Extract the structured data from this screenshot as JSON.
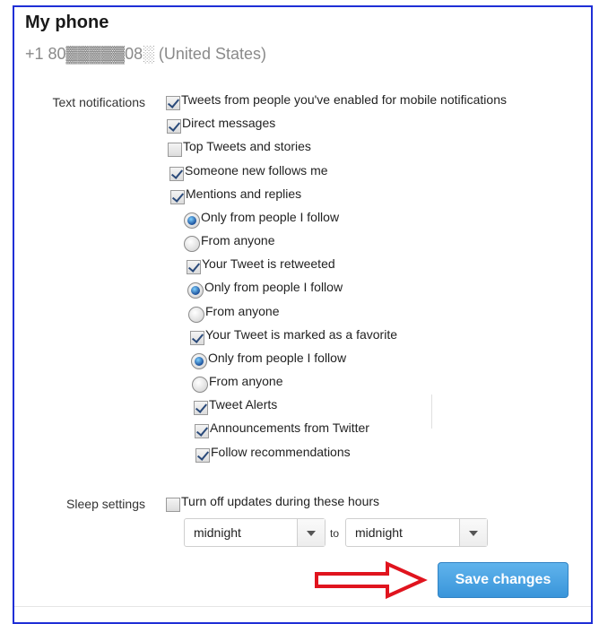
{
  "header": {
    "title": "My phone",
    "phone_number": "+1 80▓▓▓▓▓08░ (United States)"
  },
  "text_notifications": {
    "label": "Text notifications",
    "items": [
      {
        "label": "Tweets from people you've enabled for mobile notifications",
        "checked": true
      },
      {
        "label": "Direct messages",
        "checked": true
      },
      {
        "label": "Top Tweets and stories",
        "checked": false
      },
      {
        "label": "Someone new follows me",
        "checked": true
      },
      {
        "label": "Mentions and replies",
        "checked": true
      },
      {
        "label": "Only from people I follow",
        "type": "radio",
        "checked": true
      },
      {
        "label": "From anyone",
        "type": "radio",
        "checked": false
      },
      {
        "label": "Your Tweet is retweeted",
        "checked": true
      },
      {
        "label": "Only from people I follow",
        "type": "radio",
        "checked": true
      },
      {
        "label": "From anyone",
        "type": "radio",
        "checked": false
      },
      {
        "label": "Your Tweet is marked as a favorite",
        "checked": true
      },
      {
        "label": "Only from people I follow",
        "type": "radio",
        "checked": true
      },
      {
        "label": "From anyone",
        "type": "radio",
        "checked": false
      },
      {
        "label": "Tweet Alerts",
        "checked": true
      },
      {
        "label": "Announcements from Twitter",
        "checked": true
      },
      {
        "label": "Follow recommendations",
        "checked": true
      }
    ]
  },
  "sleep_settings": {
    "label": "Sleep settings",
    "checkbox_label": "Turn off updates during these hours",
    "checked": false,
    "from_value": "midnight",
    "to_label": "to",
    "to_value": "midnight"
  },
  "actions": {
    "save_label": "Save changes",
    "save_color": "#3a95da",
    "arrow_color": "#e0141e"
  }
}
